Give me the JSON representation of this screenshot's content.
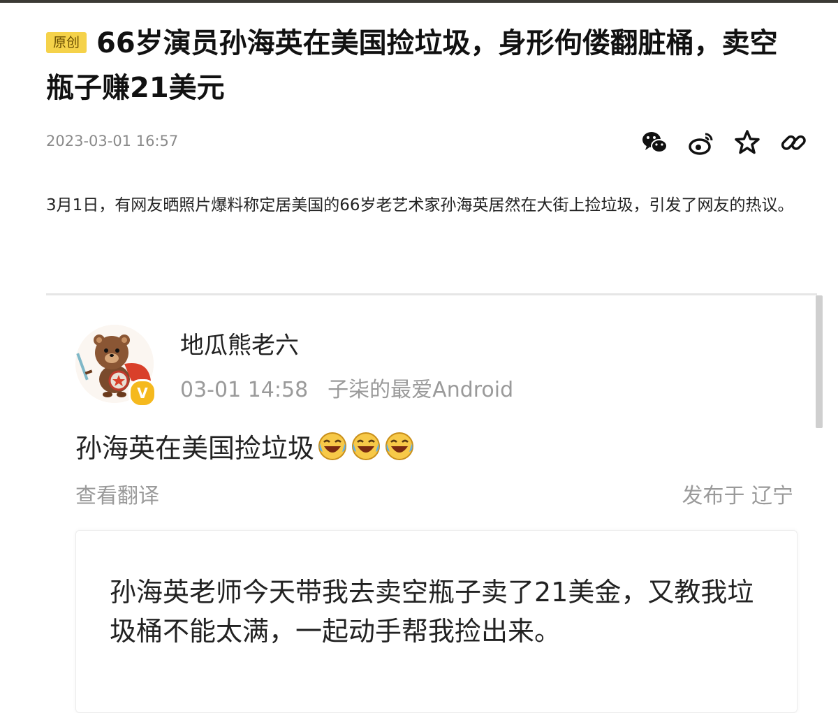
{
  "article": {
    "badge": "原创",
    "title": "66岁演员孙海英在美国捡垃圾，身形佝偻翻脏桶，卖空瓶子赚21美元",
    "date": "2023-03-01 16:57",
    "lead": "3月1日，有网友晒照片爆料称定居美国的66岁老艺术家孙海英居然在大街上捡垃圾，引发了网友的热议。"
  },
  "share_icons": [
    "wechat-icon",
    "weibo-icon",
    "star-icon",
    "link-icon"
  ],
  "quote": {
    "username": "地瓜熊老六",
    "time": "03-01 14:58",
    "source": "子柒的最爱Android",
    "verified_badge": "V",
    "post_text": "孙海英在美国捡垃圾",
    "emoji_count": 3,
    "translate": "查看翻译",
    "location": "发布于 辽宁",
    "inner_text": "孙海英老师今天带我去卖空瓶子卖了21美金，又教我垃圾桶不能太满，一起动手帮我捡出来。"
  },
  "colors": {
    "badge_bg": "#f5d24a",
    "verified": "#f5b91e",
    "muted": "#9a9a9a"
  }
}
